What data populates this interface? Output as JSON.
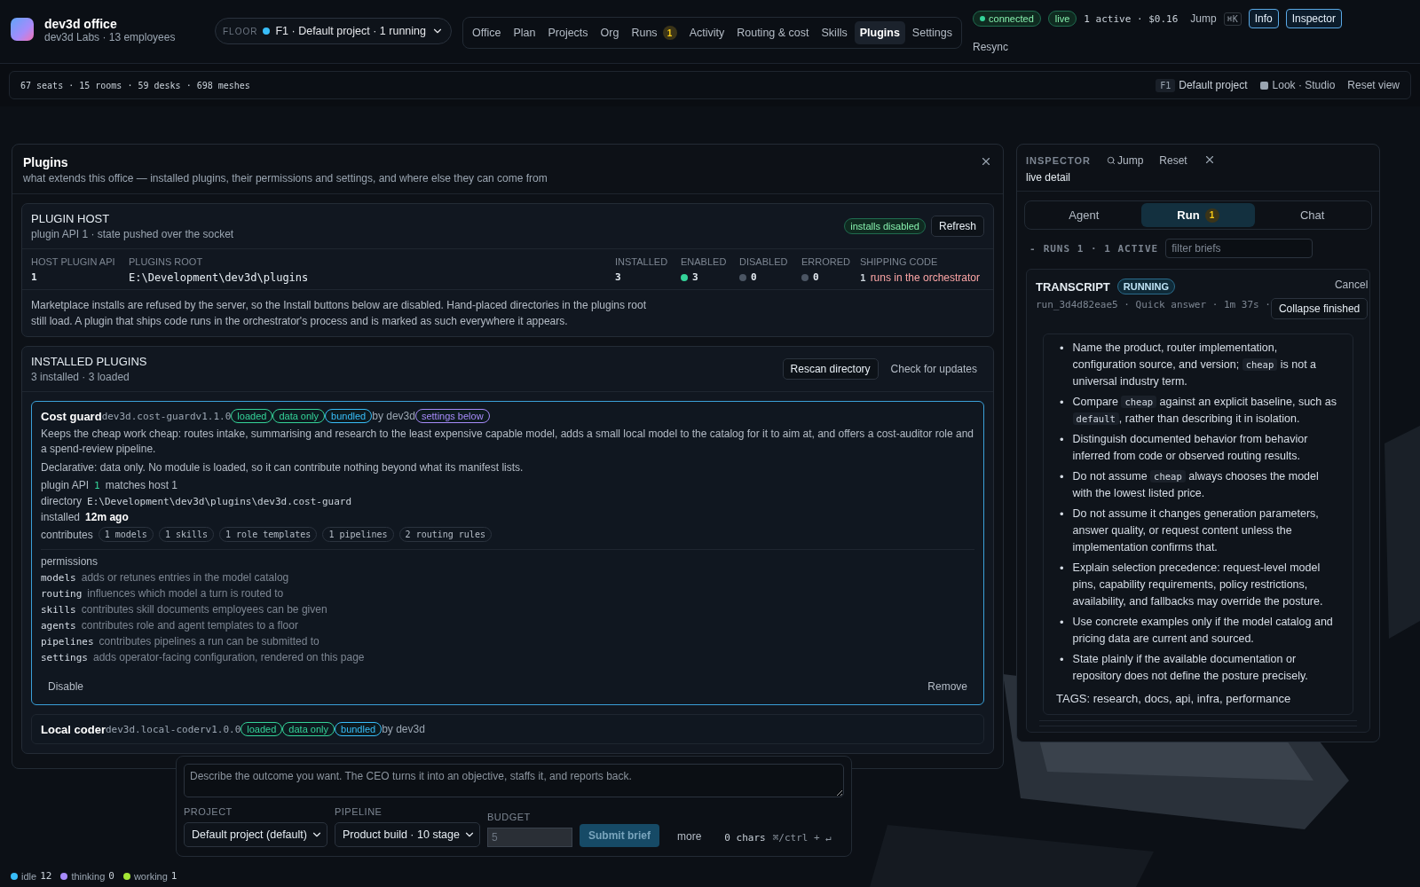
{
  "header": {
    "title": "dev3d office",
    "subtitle": "dev3d Labs · 13 employees",
    "floor_label": "FLOOR",
    "floor_value": "F1 · Default project · 1 running"
  },
  "nav": [
    {
      "label": "Office",
      "selected": false
    },
    {
      "label": "Plan",
      "selected": false
    },
    {
      "label": "Projects",
      "selected": false
    },
    {
      "label": "Org",
      "selected": false
    },
    {
      "label": "Runs",
      "badge": "1",
      "selected": false
    },
    {
      "label": "Activity",
      "selected": false
    },
    {
      "label": "Routing & cost",
      "selected": false
    },
    {
      "label": "Skills",
      "selected": false
    },
    {
      "label": "Plugins",
      "selected": true
    },
    {
      "label": "Settings",
      "selected": false
    }
  ],
  "status": {
    "connection": "connected",
    "live": "live",
    "summary": "1 active · $0.16",
    "jump": "Jump",
    "shortcut": "⌘K",
    "buttons": [
      "Info",
      "Inspector"
    ],
    "resync": "Resync"
  },
  "scene_bar": {
    "stats": "67 seats · 15 rooms · 59 desks · 698 meshes",
    "floor_tag": "F1",
    "project": "Default project",
    "look": "Look · Studio",
    "reset": "Reset view"
  },
  "plugins_panel": {
    "title": "Plugins",
    "subtitle": "what extends this office — installed plugins, their permissions and settings, and where else they can come from",
    "host": {
      "title": "PLUGIN HOST",
      "subtitle": "plugin API 1 · state pushed over the socket",
      "badge": "installs disabled",
      "button": "Refresh",
      "stats": [
        {
          "label": "HOST PLUGIN API",
          "value": "1",
          "kind": "plain"
        },
        {
          "label": "PLUGINS ROOT",
          "value": "E:\\Development\\dev3d\\plugins",
          "kind": "path"
        },
        {
          "label": "INSTALLED",
          "value": "3",
          "kind": "plain"
        },
        {
          "label": "ENABLED",
          "value": "3",
          "kind": "dot",
          "color": "#34d399"
        },
        {
          "label": "DISABLED",
          "value": "0",
          "kind": "dot",
          "color": "#4b5563"
        },
        {
          "label": "ERRORED",
          "value": "0",
          "kind": "dot",
          "color": "#4b5563"
        },
        {
          "label": "SHIPPING CODE",
          "value": "1",
          "note": "runs in the orchestrator",
          "kind": "warn"
        }
      ],
      "note": "Marketplace installs are refused by the server, so the Install buttons below are disabled. Hand-placed directories in the plugins root still load. A plugin that ships code runs in the orchestrator's process and is marked as such everywhere it appears."
    },
    "installed": {
      "title": "INSTALLED PLUGINS",
      "subtitle": "3 installed · 3 loaded",
      "buttons": [
        "Rescan directory",
        "Check for updates"
      ],
      "plugins": [
        {
          "name": "Cost guard",
          "id": "dev3d.cost-guard",
          "version": "v1.1.0",
          "selected": true,
          "badges": [
            {
              "label": "loaded",
              "color": "#34d399"
            },
            {
              "label": "data only",
              "color": "#34d399"
            },
            {
              "label": "bundled",
              "color": "#38bdf8"
            }
          ],
          "author": "by dev3d",
          "extra_badge": {
            "label": "settings below",
            "color": "#a78bfa"
          },
          "description": "Keeps the cheap work cheap: routes intake, summarising and research to the least expensive capable model, adds a small local model to the catalog for it to aim at, and offers a cost-auditor role and a spend-review pipeline.",
          "declarative": "Declarative: data only. No module is loaded, so it can contribute nothing beyond what its manifest lists.",
          "api_label": "plugin API",
          "api_value": "1",
          "api_note": "matches host 1",
          "directory_label": "directory",
          "directory": "E:\\Development\\dev3d\\plugins\\dev3d.cost-guard",
          "installed_label": "installed",
          "installed": "12m ago",
          "contributes_label": "contributes",
          "contributions": [
            "1 models",
            "1 skills",
            "1 role templates",
            "1 pipelines",
            "2 routing rules"
          ],
          "permissions_label": "permissions",
          "permissions": [
            {
              "key": "models",
              "text": "adds or retunes entries in the model catalog"
            },
            {
              "key": "routing",
              "text": "influences which model a turn is routed to"
            },
            {
              "key": "skills",
              "text": "contributes skill documents employees can be given"
            },
            {
              "key": "agents",
              "text": "contributes role and agent templates to a floor"
            },
            {
              "key": "pipelines",
              "text": "contributes pipelines a run can be submitted to"
            },
            {
              "key": "settings",
              "text": "adds operator-facing configuration, rendered on this page"
            }
          ],
          "actions": [
            "Disable",
            "Remove"
          ]
        },
        {
          "name": "Local coder",
          "id": "dev3d.local-coder",
          "version": "v1.0.0",
          "selected": false,
          "badges": [
            {
              "label": "loaded",
              "color": "#34d399"
            },
            {
              "label": "data only",
              "color": "#34d399"
            },
            {
              "label": "bundled",
              "color": "#38bdf8"
            }
          ],
          "author": "by dev3d"
        }
      ]
    }
  },
  "inspector": {
    "label": "INSPECTOR",
    "jump": "Jump",
    "reset": "Reset",
    "subtitle": "live detail",
    "tabs": [
      {
        "label": "Agent",
        "selected": false
      },
      {
        "label": "Run",
        "badge": "1",
        "selected": true
      },
      {
        "label": "Chat",
        "selected": false
      }
    ],
    "runs_toggle": "-",
    "runs_label": "RUNS 1 · 1 ACTIVE",
    "filter_placeholder": "filter briefs",
    "transcript": {
      "title": "TRANSCRIPT",
      "status": "RUNNING",
      "meta": "run_3d4d82eae5 · Quick answer · 1m 37s ·",
      "cancel": "Cancel",
      "collapse": "Collapse finished",
      "marker": "•",
      "bullets": [
        [
          {
            "kind": "text",
            "text": "Name the product, router implementation, configuration source, and version; "
          },
          {
            "kind": "code",
            "text": "cheap"
          },
          {
            "kind": "text",
            "text": " is not a universal industry term."
          }
        ],
        [
          {
            "kind": "text",
            "text": "Compare "
          },
          {
            "kind": "code",
            "text": "cheap"
          },
          {
            "kind": "text",
            "text": " against an explicit baseline, such as "
          },
          {
            "kind": "code",
            "text": "default"
          },
          {
            "kind": "text",
            "text": ", rather than describing it in isolation."
          }
        ],
        [
          {
            "kind": "text",
            "text": "Distinguish documented behavior from behavior inferred from code or observed routing results."
          }
        ],
        [
          {
            "kind": "text",
            "text": "Do not assume "
          },
          {
            "kind": "code",
            "text": "cheap"
          },
          {
            "kind": "text",
            "text": " always chooses the model with the lowest listed price."
          }
        ],
        [
          {
            "kind": "text",
            "text": "Do not assume it changes generation parameters, answer quality, or request content unless the implementation confirms that."
          }
        ],
        [
          {
            "kind": "text",
            "text": "Explain selection precedence: request-level model pins, capability requirements, policy restrictions, availability, and fallbacks may override the posture."
          }
        ],
        [
          {
            "kind": "text",
            "text": "Use concrete examples only if the model catalog and pricing data are current and sourced."
          }
        ],
        [
          {
            "kind": "text",
            "text": "State plainly if the available documentation or repository does not define the posture precisely."
          }
        ]
      ],
      "tags": "TAGS: research, docs, api, infra, performance"
    }
  },
  "composer": {
    "placeholder": "Describe the outcome you want. The CEO turns it into an objective, staffs it, and reports back.",
    "project_label": "PROJECT",
    "project": "Default project (default)",
    "pipeline_label": "PIPELINE",
    "pipeline": "Product build · 10 stage",
    "budget_label": "BUDGET",
    "budget_placeholder": "5",
    "submit": "Submit brief",
    "more": "more",
    "count": "0 chars",
    "shortcut": "⌘/ctrl + ↵"
  },
  "status_bar": [
    {
      "label": "idle",
      "count": "12",
      "color": "#38bdf8"
    },
    {
      "label": "thinking",
      "count": "0",
      "color": "#a78bfa"
    },
    {
      "label": "working",
      "count": "1",
      "color": "#a3e635"
    }
  ]
}
